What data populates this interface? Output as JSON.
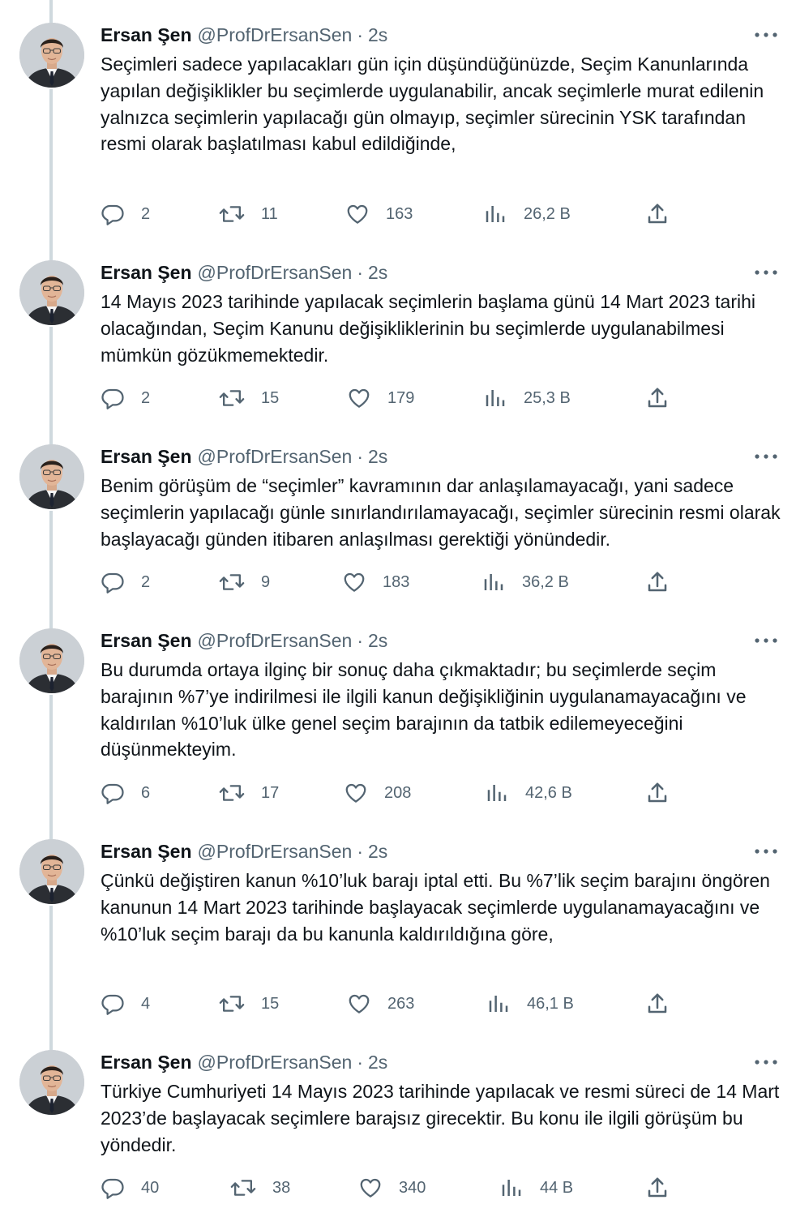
{
  "author": {
    "name": "Ersan Şen",
    "handle": "@ProfDrErsanSen",
    "separator": "·",
    "time": "2s"
  },
  "colors": {
    "text": "#0f1419",
    "secondary": "#536471",
    "thread_line": "#cfd9de"
  },
  "icons": {
    "reply": "reply-icon",
    "retweet": "retweet-icon",
    "like": "heart-icon",
    "views": "views-icon",
    "share": "share-icon",
    "more": "more-icon"
  },
  "tweets": [
    {
      "text": "Seçimleri sadece yapılacakları gün için düşündüğünüzde, Seçim Kanunlarında yapılan değişiklikler bu seçimlerde uygulanabilir, ancak seçimlerle murat edilenin yalnızca seçimlerin yapılacağı gün olmayıp, seçimler sürecinin YSK tarafından resmi olarak başlatılması kabul edildiğinde,",
      "replies": "2",
      "retweets": "11",
      "likes": "163",
      "views": "26,2 B"
    },
    {
      "text": "14 Mayıs 2023 tarihinde yapılacak seçimlerin başlama günü 14 Mart 2023 tarihi olacağından, Seçim Kanunu değişikliklerinin bu seçimlerde uygulanabilmesi mümkün gözükmemektedir.",
      "replies": "2",
      "retweets": "15",
      "likes": "179",
      "views": "25,3 B"
    },
    {
      "text": "Benim görüşüm de “seçimler” kavramının dar anlaşılamayacağı, yani sadece seçimlerin yapılacağı günle sınırlandırılamayacağı, seçimler sürecinin resmi olarak başlayacağı günden itibaren anlaşılması gerektiği yönündedir.",
      "replies": "2",
      "retweets": "9",
      "likes": "183",
      "views": "36,2 B"
    },
    {
      "text": "Bu durumda ortaya ilginç bir sonuç daha çıkmaktadır; bu seçimlerde seçim barajının %7’ye indirilmesi ile ilgili kanun değişikliğinin uygulanamayacağını ve kaldırılan %10’luk ülke genel seçim barajının da tatbik edilemeyeceğini düşünmekteyim.",
      "replies": "6",
      "retweets": "17",
      "likes": "208",
      "views": "42,6 B"
    },
    {
      "text": "Çünkü değiştiren kanun %10’luk barajı iptal etti. Bu %7’lik seçim barajını öngören kanunun 14 Mart 2023 tarihinde başlayacak seçimlerde uygulanamayacağını ve %10’luk seçim barajı da bu kanunla kaldırıldığına göre,",
      "replies": "4",
      "retweets": "15",
      "likes": "263",
      "views": "46,1 B"
    },
    {
      "text": "Türkiye Cumhuriyeti 14 Mayıs 2023 tarihinde yapılacak ve resmi süreci de 14 Mart 2023’de başlayacak seçimlere barajsız girecektir. Bu konu ile ilgili görüşüm bu yöndedir.",
      "replies": "40",
      "retweets": "38",
      "likes": "340",
      "views": "44 B"
    }
  ]
}
